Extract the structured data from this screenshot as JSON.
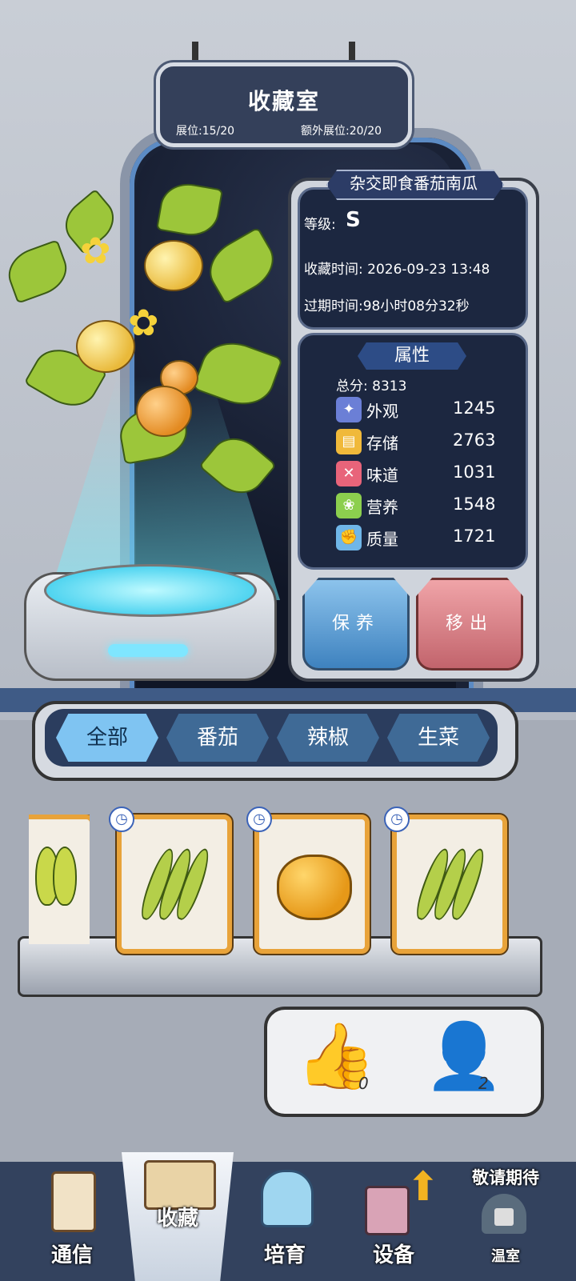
{
  "header": {
    "title": "收藏室",
    "slots": "展位:15/20",
    "extra_slots": "额外展位:20/20"
  },
  "plant": {
    "name": "杂交即食番茄南瓜",
    "grade_label": "等级:",
    "grade_value": "S",
    "collect_time": "收藏时间: 2026-09-23 13:48",
    "expire_time": "过期时间:98小时08分32秒"
  },
  "attributes": {
    "title": "属性",
    "total": "总分: 8313",
    "stats": [
      {
        "name": "外观",
        "value": "1245",
        "icon": "sparkle-icon",
        "color": "#6b7fd6"
      },
      {
        "name": "存储",
        "value": "2763",
        "icon": "storage-icon",
        "color": "#f0b93a"
      },
      {
        "name": "味道",
        "value": "1031",
        "icon": "utensils-icon",
        "color": "#e8647a"
      },
      {
        "name": "营养",
        "value": "1548",
        "icon": "nutrition-icon",
        "color": "#8ccf4e"
      },
      {
        "name": "质量",
        "value": "1721",
        "icon": "muscle-icon",
        "color": "#6fb6e8"
      }
    ]
  },
  "actions": {
    "care": "保养",
    "remove": "移出"
  },
  "tabs": [
    "全部",
    "番茄",
    "辣椒",
    "生菜"
  ],
  "social": {
    "likes": "0",
    "visitors": "2"
  },
  "nav": {
    "items": [
      "通信",
      "收藏",
      "培育",
      "设备",
      "温室"
    ],
    "coming_soon": "敬请期待"
  }
}
